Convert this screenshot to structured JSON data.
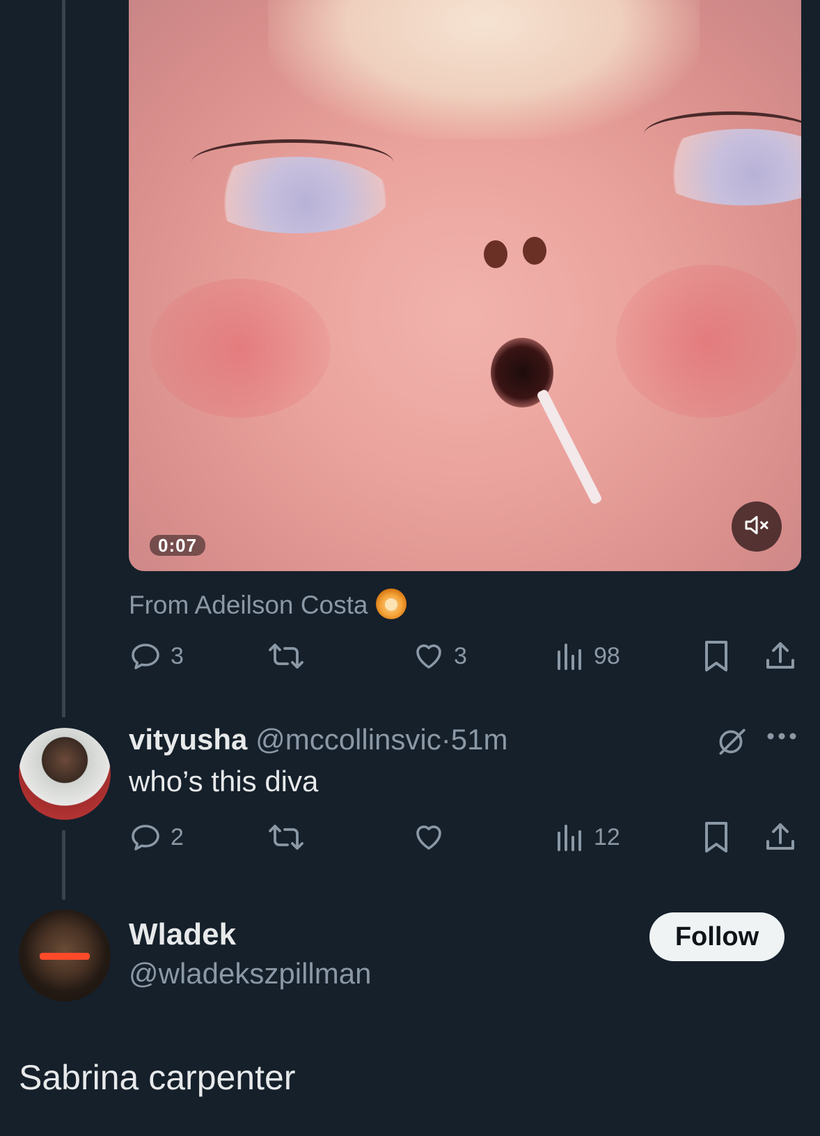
{
  "video": {
    "timestamp": "0:07",
    "mute_icon": "speaker-muted-icon"
  },
  "source": {
    "label": "From Adeilson Costa",
    "emoji_icon": "lion-face-icon"
  },
  "post_actions": {
    "replies": "3",
    "reposts": "",
    "likes": "3",
    "views": "98"
  },
  "reply": {
    "display_name": "vityusha",
    "handle": "@mccollinsvic",
    "separator": "·",
    "time": "51m",
    "text": "who’s this diva",
    "actions": {
      "replies": "2",
      "reposts": "",
      "likes": "",
      "views": "12"
    }
  },
  "main_post": {
    "display_name": "Wladek",
    "handle": "@wladekszpillman",
    "follow_label": "Follow",
    "text": "Sabrina carpenter"
  },
  "colors": {
    "background": "#15202b",
    "text_primary": "#e7e9ea",
    "text_muted": "#8b98a5",
    "thread_line": "#38444d"
  }
}
